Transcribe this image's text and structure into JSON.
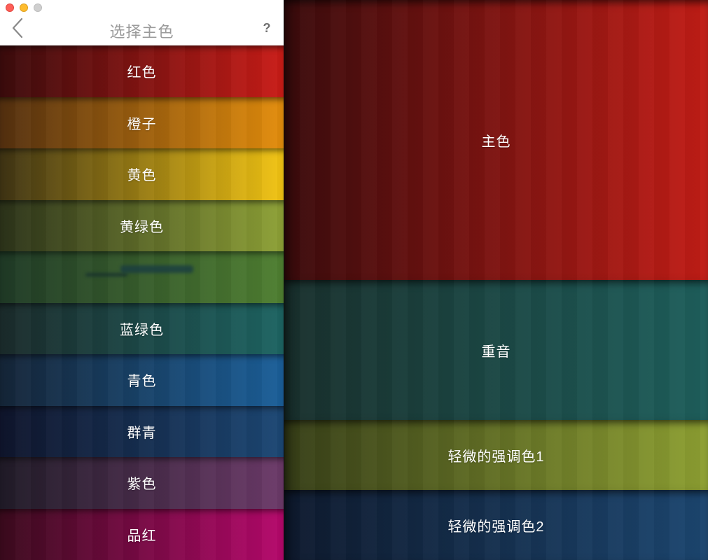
{
  "header": {
    "title": "选择主色",
    "back_icon": "chevron-left-icon",
    "help_label": "?"
  },
  "colors": [
    {
      "label": "红色",
      "from": "#3b0b0c",
      "to": "#c91c17"
    },
    {
      "label": "橙子",
      "from": "#54300f",
      "to": "#e38d0c"
    },
    {
      "label": "黄色",
      "from": "#3f3414",
      "to": "#f2c413"
    },
    {
      "label": "黄绿色",
      "from": "#2c331a",
      "to": "#8ea136"
    },
    {
      "from": "#1f3a26",
      "to": "#4f7f31"
    },
    {
      "label": "蓝绿色",
      "from": "#1b2b2b",
      "to": "#1d6462"
    },
    {
      "label": "青色",
      "from": "#152538",
      "to": "#1b5f99"
    },
    {
      "label": "群青",
      "from": "#0f152c",
      "to": "#1c4774"
    },
    {
      "label": "紫色",
      "from": "#201b27",
      "to": "#6c3a69"
    },
    {
      "label": "品红",
      "from": "#3b0a1d",
      "to": "#b5086b"
    }
  ],
  "preview": {
    "primary": {
      "label": "主色",
      "from": "#3a0b0c",
      "to": "#c21d16"
    },
    "accent": {
      "label": "重音",
      "from": "#19302d",
      "to": "#1e5f5c"
    },
    "subtle_accent_1": {
      "label": "轻微的强调色1",
      "from": "#373f18",
      "to": "#8ea032"
    },
    "subtle_accent_2": {
      "label": "轻微的强调色2",
      "from": "#0e1a2e",
      "to": "#1c4670"
    }
  }
}
